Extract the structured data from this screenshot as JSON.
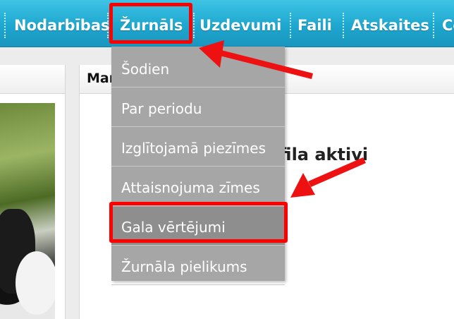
{
  "nav": {
    "items": [
      {
        "label": "Nodarbības"
      },
      {
        "label": "Žurnāls"
      },
      {
        "label": "Uzdevumi"
      },
      {
        "label": "Faili"
      },
      {
        "label": "Atskaites"
      },
      {
        "label": "Co"
      }
    ]
  },
  "dropdown": {
    "items": [
      {
        "label": "Šodien"
      },
      {
        "label": "Par periodu"
      },
      {
        "label": "Izglītojamā piezīmes"
      },
      {
        "label": "Attaisnojuma zīmes"
      },
      {
        "label": "Gala vērtējumi"
      },
      {
        "label": "Žurnāla pielikums"
      }
    ]
  },
  "content": {
    "panel_title": "Mar",
    "empty_message": "Nav profila aktivi"
  },
  "colors": {
    "nav_bg": "#1ea7cf",
    "dropdown_bg": "#a6a6a6",
    "highlight": "#ff0000"
  }
}
